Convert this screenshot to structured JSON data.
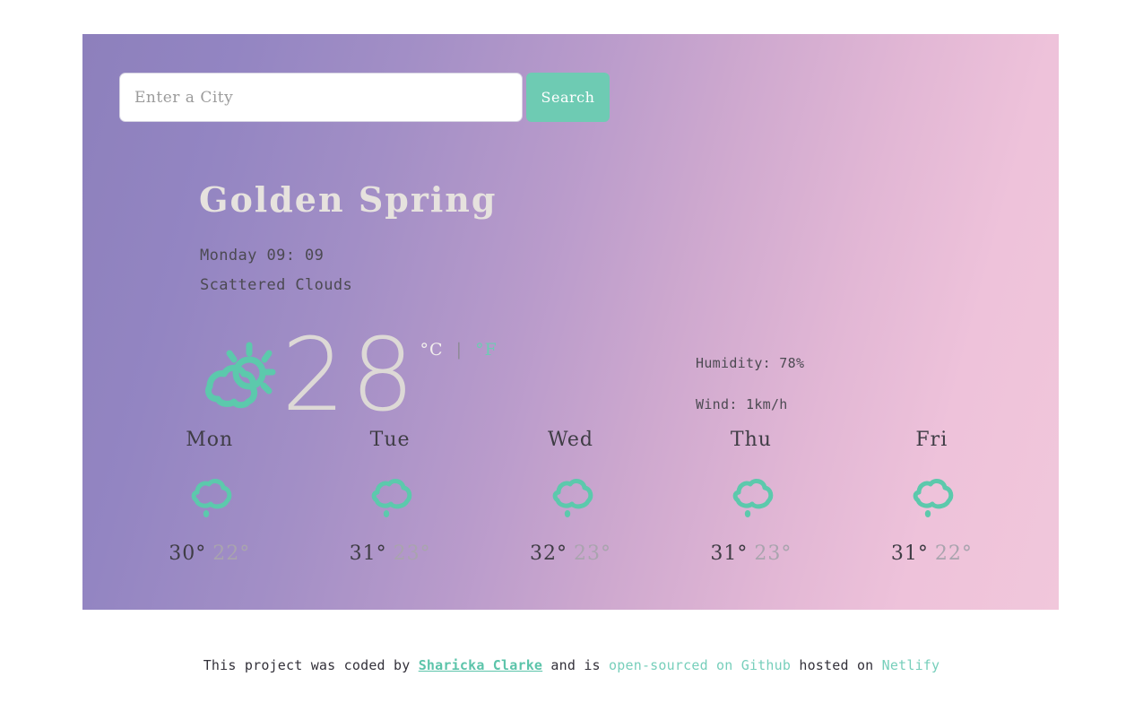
{
  "search": {
    "placeholder": "Enter a City",
    "value": "",
    "button_label": "Search"
  },
  "current": {
    "city": "Golden Spring",
    "datetime": "Monday 09: 09",
    "description": "Scattered Clouds",
    "temperature": "28",
    "unit_celsius": "°C",
    "unit_separator": "|",
    "unit_fahrenheit": "°F",
    "icon": "sun-behind-cloud-icon",
    "humidity_label": "Humidity: 78%",
    "wind_label": "Wind: 1km/h"
  },
  "forecast": [
    {
      "day": "Mon",
      "icon": "rain-cloud-icon",
      "temp_max": "30°",
      "temp_min": "22°"
    },
    {
      "day": "Tue",
      "icon": "rain-cloud-icon",
      "temp_max": "31°",
      "temp_min": "23°"
    },
    {
      "day": "Wed",
      "icon": "rain-cloud-icon",
      "temp_max": "32°",
      "temp_min": "23°"
    },
    {
      "day": "Thu",
      "icon": "rain-cloud-icon",
      "temp_max": "31°",
      "temp_min": "23°"
    },
    {
      "day": "Fri",
      "icon": "rain-cloud-icon",
      "temp_max": "31°",
      "temp_min": "22°"
    }
  ],
  "footer": {
    "prefix": "This project was coded by ",
    "author": "Sharicka Clarke",
    "middle": " and is ",
    "source_link": "open-sourced on Github",
    "hosted_text": " hosted on ",
    "host_link": "Netlify"
  },
  "colors": {
    "accent_teal": "#6ecbb3",
    "gradient_start": "#8d80bc",
    "gradient_end": "#f1c7db",
    "text_dark": "#4c4a52",
    "title_cream": "#e6e2de"
  }
}
